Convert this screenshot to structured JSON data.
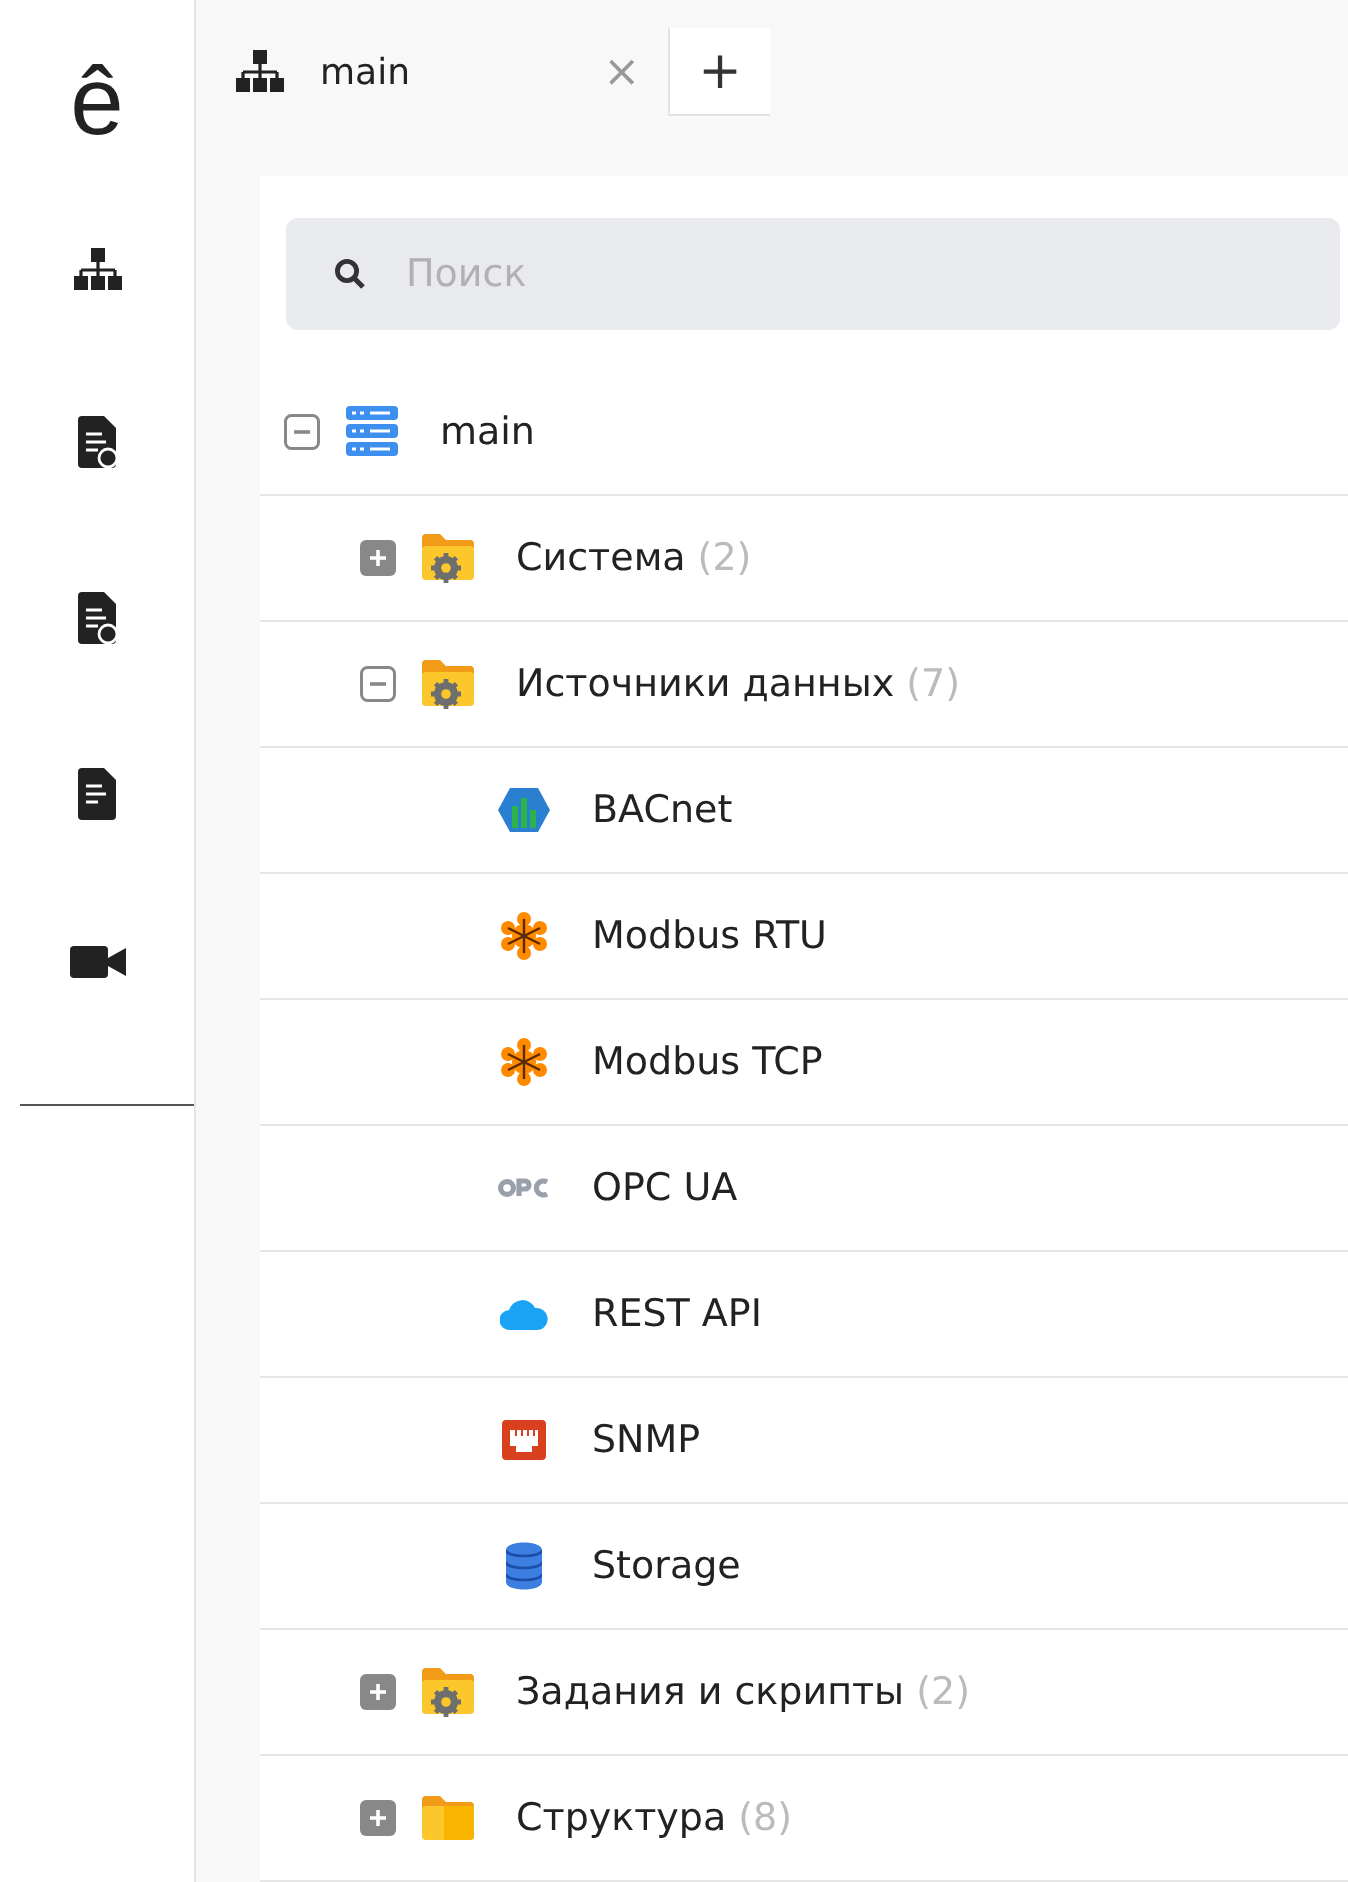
{
  "logo": "ê",
  "sidebar": {
    "items": [
      {
        "kind": "hierarchy"
      },
      {
        "kind": "doc-check"
      },
      {
        "kind": "doc-clock"
      },
      {
        "kind": "doc"
      },
      {
        "kind": "camera"
      }
    ]
  },
  "tabs": [
    {
      "label": "main",
      "selected": true,
      "close": "×"
    }
  ],
  "new_tab": "+",
  "search": {
    "placeholder": "Поиск"
  },
  "tree": [
    {
      "kind": "server",
      "label": "main",
      "expanded": true,
      "children": [
        {
          "kind": "folder-gear",
          "label": "Система",
          "count": "(2)",
          "expanded": false
        },
        {
          "kind": "folder-gear",
          "label": "Источники данных",
          "count": "(7)",
          "expanded": true,
          "children": [
            {
              "kind": "bacnet",
              "label": "BACnet"
            },
            {
              "kind": "modbus",
              "label": "Modbus RTU"
            },
            {
              "kind": "modbus",
              "label": "Modbus TCP"
            },
            {
              "kind": "opc",
              "label": "OPC UA"
            },
            {
              "kind": "cloud",
              "label": "REST API"
            },
            {
              "kind": "snmp",
              "label": "SNMP"
            },
            {
              "kind": "database",
              "label": "Storage"
            }
          ]
        },
        {
          "kind": "folder-gear",
          "label": "Задания и скрипты",
          "count": "(2)",
          "expanded": false
        },
        {
          "kind": "folder",
          "label": "Структура",
          "count": "(8)",
          "expanded": false
        }
      ]
    }
  ]
}
